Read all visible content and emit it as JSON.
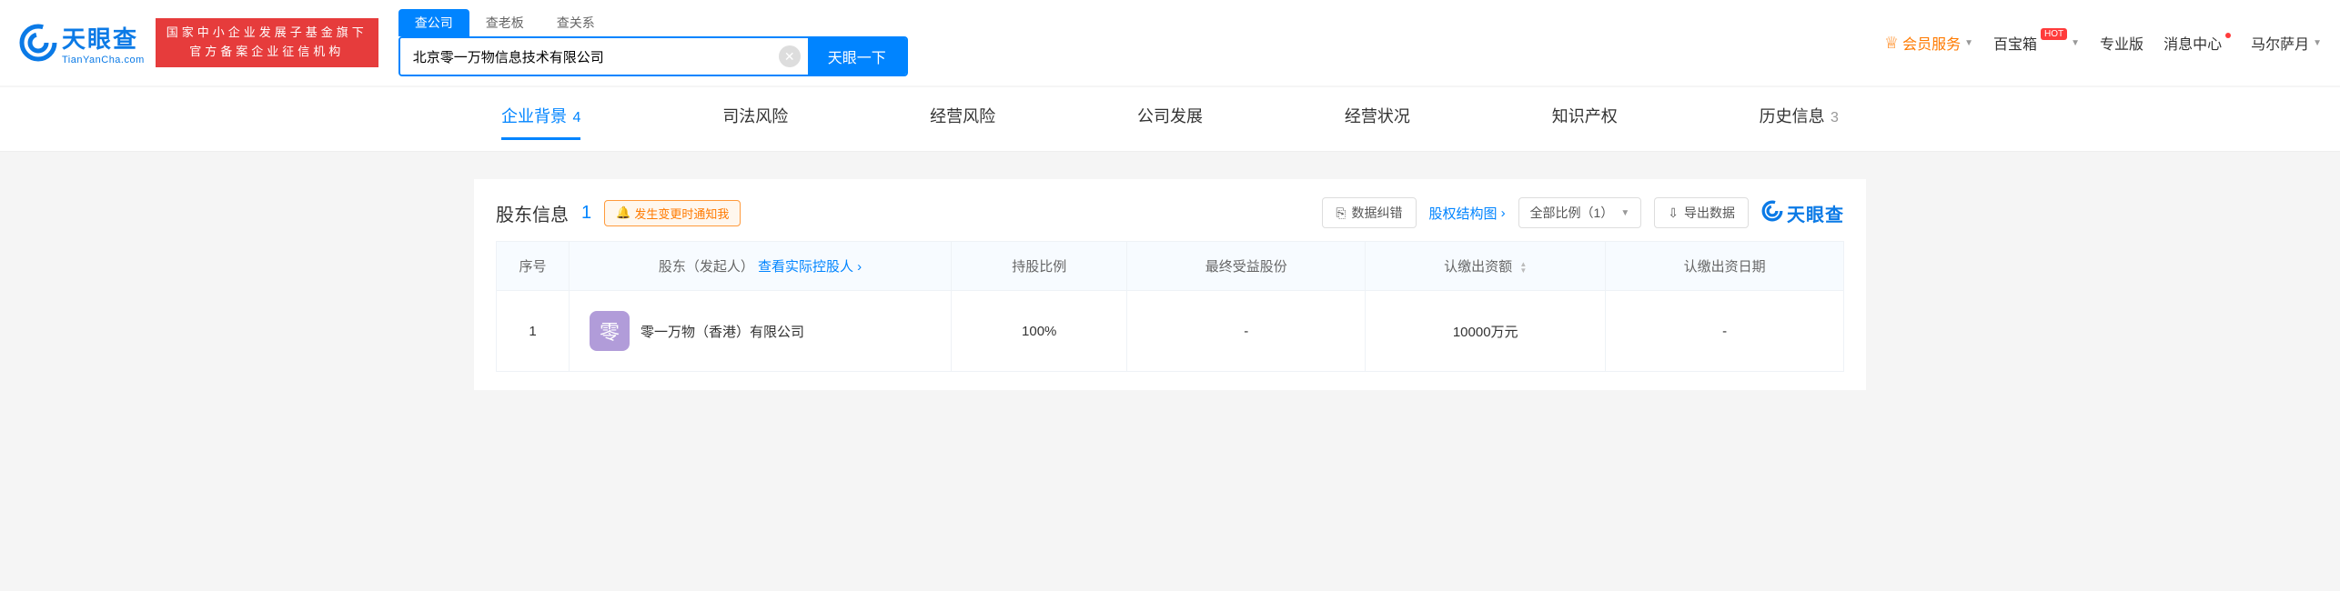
{
  "header": {
    "logo_title": "天眼查",
    "logo_sub": "TianYanCha.com",
    "banner_line1": "国家中小企业发展子基金旗下",
    "banner_line2": "官方备案企业征信机构",
    "search_tabs": [
      "查公司",
      "查老板",
      "查关系"
    ],
    "search_value": "北京零一万物信息技术有限公司",
    "search_btn": "天眼一下",
    "vip_label": "会员服务",
    "nav_treasure": "百宝箱",
    "hot_label": "HOT",
    "nav_pro": "专业版",
    "nav_msg": "消息中心",
    "nav_user": "马尔萨月"
  },
  "categories": [
    {
      "label": "企业背景",
      "count": "4",
      "active": true
    },
    {
      "label": "司法风险"
    },
    {
      "label": "经营风险"
    },
    {
      "label": "公司发展"
    },
    {
      "label": "经营状况"
    },
    {
      "label": "知识产权"
    },
    {
      "label": "历史信息",
      "count": "3"
    }
  ],
  "section": {
    "title": "股东信息",
    "count": "1",
    "notify_label": "发生变更时通知我",
    "correct_label": "数据纠错",
    "structure_label": "股权结构图",
    "ratio_select": "全部比例（1）",
    "export_label": "导出数据",
    "watermark": "天眼查"
  },
  "table": {
    "headers": {
      "seq": "序号",
      "shareholder": "股东（发起人）",
      "view_controller": "查看实际控股人",
      "ratio": "持股比例",
      "benefit": "最终受益股份",
      "amount": "认缴出资额",
      "date": "认缴出资日期"
    },
    "rows": [
      {
        "seq": "1",
        "logo_char": "零",
        "name": "零一万物（香港）有限公司",
        "ratio": "100%",
        "benefit": "-",
        "amount": "10000万元",
        "date": "-"
      }
    ]
  }
}
